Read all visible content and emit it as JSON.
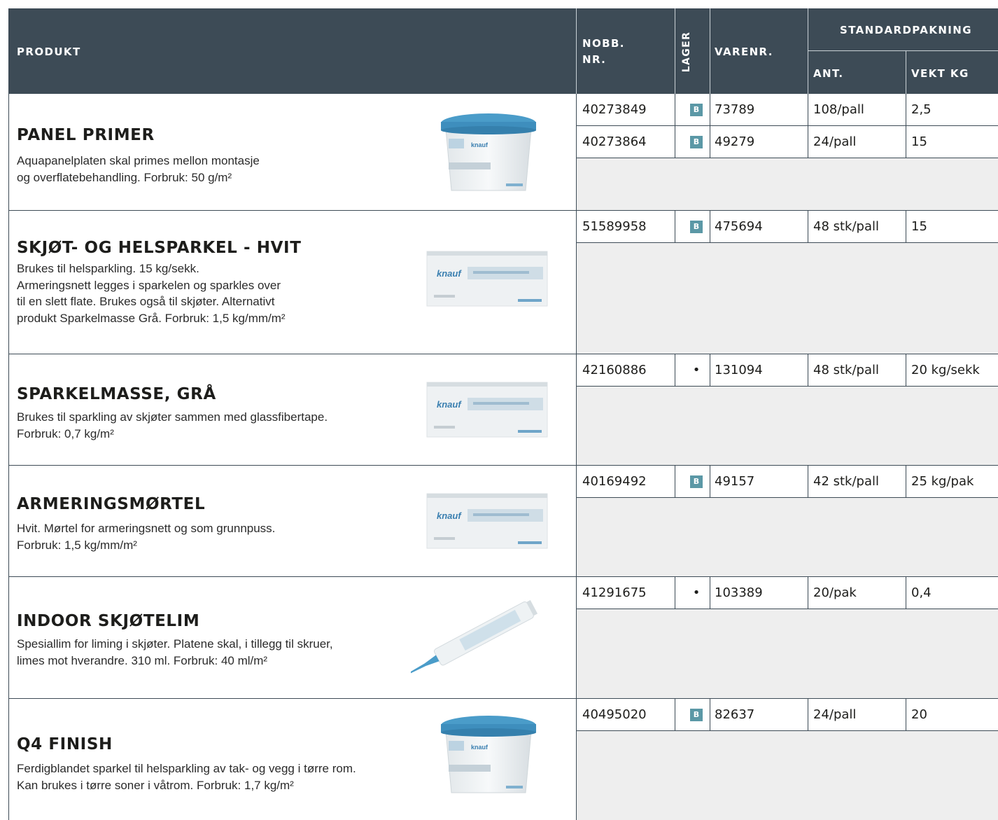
{
  "header": {
    "produkt": "PRODUKT",
    "nobb_line1": "NOBB.",
    "nobb_line2": "NR.",
    "lager": "LAGER",
    "varenr": "VARENR.",
    "standardpakning": "STANDARDPAKNING",
    "ant": "ANT.",
    "vekt": "VEKT KG"
  },
  "colors": {
    "header_bg": "#3d4b56",
    "badge": "#5b98a6",
    "row_fill": "#eeeeee"
  },
  "products": [
    {
      "title": "PANEL PRIMER",
      "desc": "Aquapanelplaten skal primes mellon montasje\nog overflatebehandling. Forbruk: 50 g/m²",
      "image": "bucket-icon",
      "brand": "knauf",
      "lines": [
        {
          "nobb": "40273849",
          "lager": "B",
          "varenr": "73789",
          "ant": "108/pall",
          "vekt": "2,5"
        },
        {
          "nobb": "40273864",
          "lager": "B",
          "varenr": "49279",
          "ant": "24/pall",
          "vekt": "15"
        }
      ]
    },
    {
      "title": "SKJØT- OG HELSPARKEL - HVIT",
      "desc": "Brukes til helsparkling. 15 kg/sekk.\nArmeringsnett legges i sparkelen og sparkles over\ntil en slett flate. Brukes også til skjøter. Alternativt\nprodukt Sparkelmasse Grå. Forbruk: 1,5 kg/mm/m²",
      "image": "sack-icon",
      "brand": "knauf",
      "lines": [
        {
          "nobb": "51589958",
          "lager": "B",
          "varenr": "475694",
          "ant": "48 stk/pall",
          "vekt": "15"
        }
      ]
    },
    {
      "title": "SPARKELMASSE, GRÅ",
      "desc": "Brukes til sparkling av skjøter sammen med glassfibertape.\nForbruk: 0,7 kg/m²",
      "image": "sack-icon",
      "brand": "knauf",
      "lines": [
        {
          "nobb": "42160886",
          "lager": "•",
          "varenr": "131094",
          "ant": "48 stk/pall",
          "vekt": "20 kg/sekk"
        }
      ]
    },
    {
      "title": "ARMERINGSMØRTEL",
      "desc": "Hvit. Mørtel for armeringsnett og som grunnpuss.\nForbruk: 1,5 kg/mm/m²",
      "image": "sack-icon",
      "brand": "knauf",
      "lines": [
        {
          "nobb": "40169492",
          "lager": "B",
          "varenr": "49157",
          "ant": "42 stk/pall",
          "vekt": "25 kg/pak"
        }
      ]
    },
    {
      "title": "INDOOR SKJØTELIM",
      "desc": "Spesiallim for liming i skjøter. Platene skal, i tillegg til skruer,\nlimes mot hverandre. 310 ml. Forbruk: 40 ml/m²",
      "image": "cartridge-icon",
      "brand": "",
      "lines": [
        {
          "nobb": "41291675",
          "lager": "•",
          "varenr": "103389",
          "ant": "20/pak",
          "vekt": "0,4"
        }
      ]
    },
    {
      "title": "Q4 FINISH",
      "desc": "Ferdigblandet sparkel til helsparkling av tak- og vegg i tørre rom.\nKan brukes i tørre soner i våtrom. Forbruk: 1,7 kg/m²",
      "image": "bucket-icon",
      "brand": "knauf",
      "lines": [
        {
          "nobb": "40495020",
          "lager": "B",
          "varenr": "82637",
          "ant": "24/pall",
          "vekt": "20"
        }
      ]
    }
  ]
}
